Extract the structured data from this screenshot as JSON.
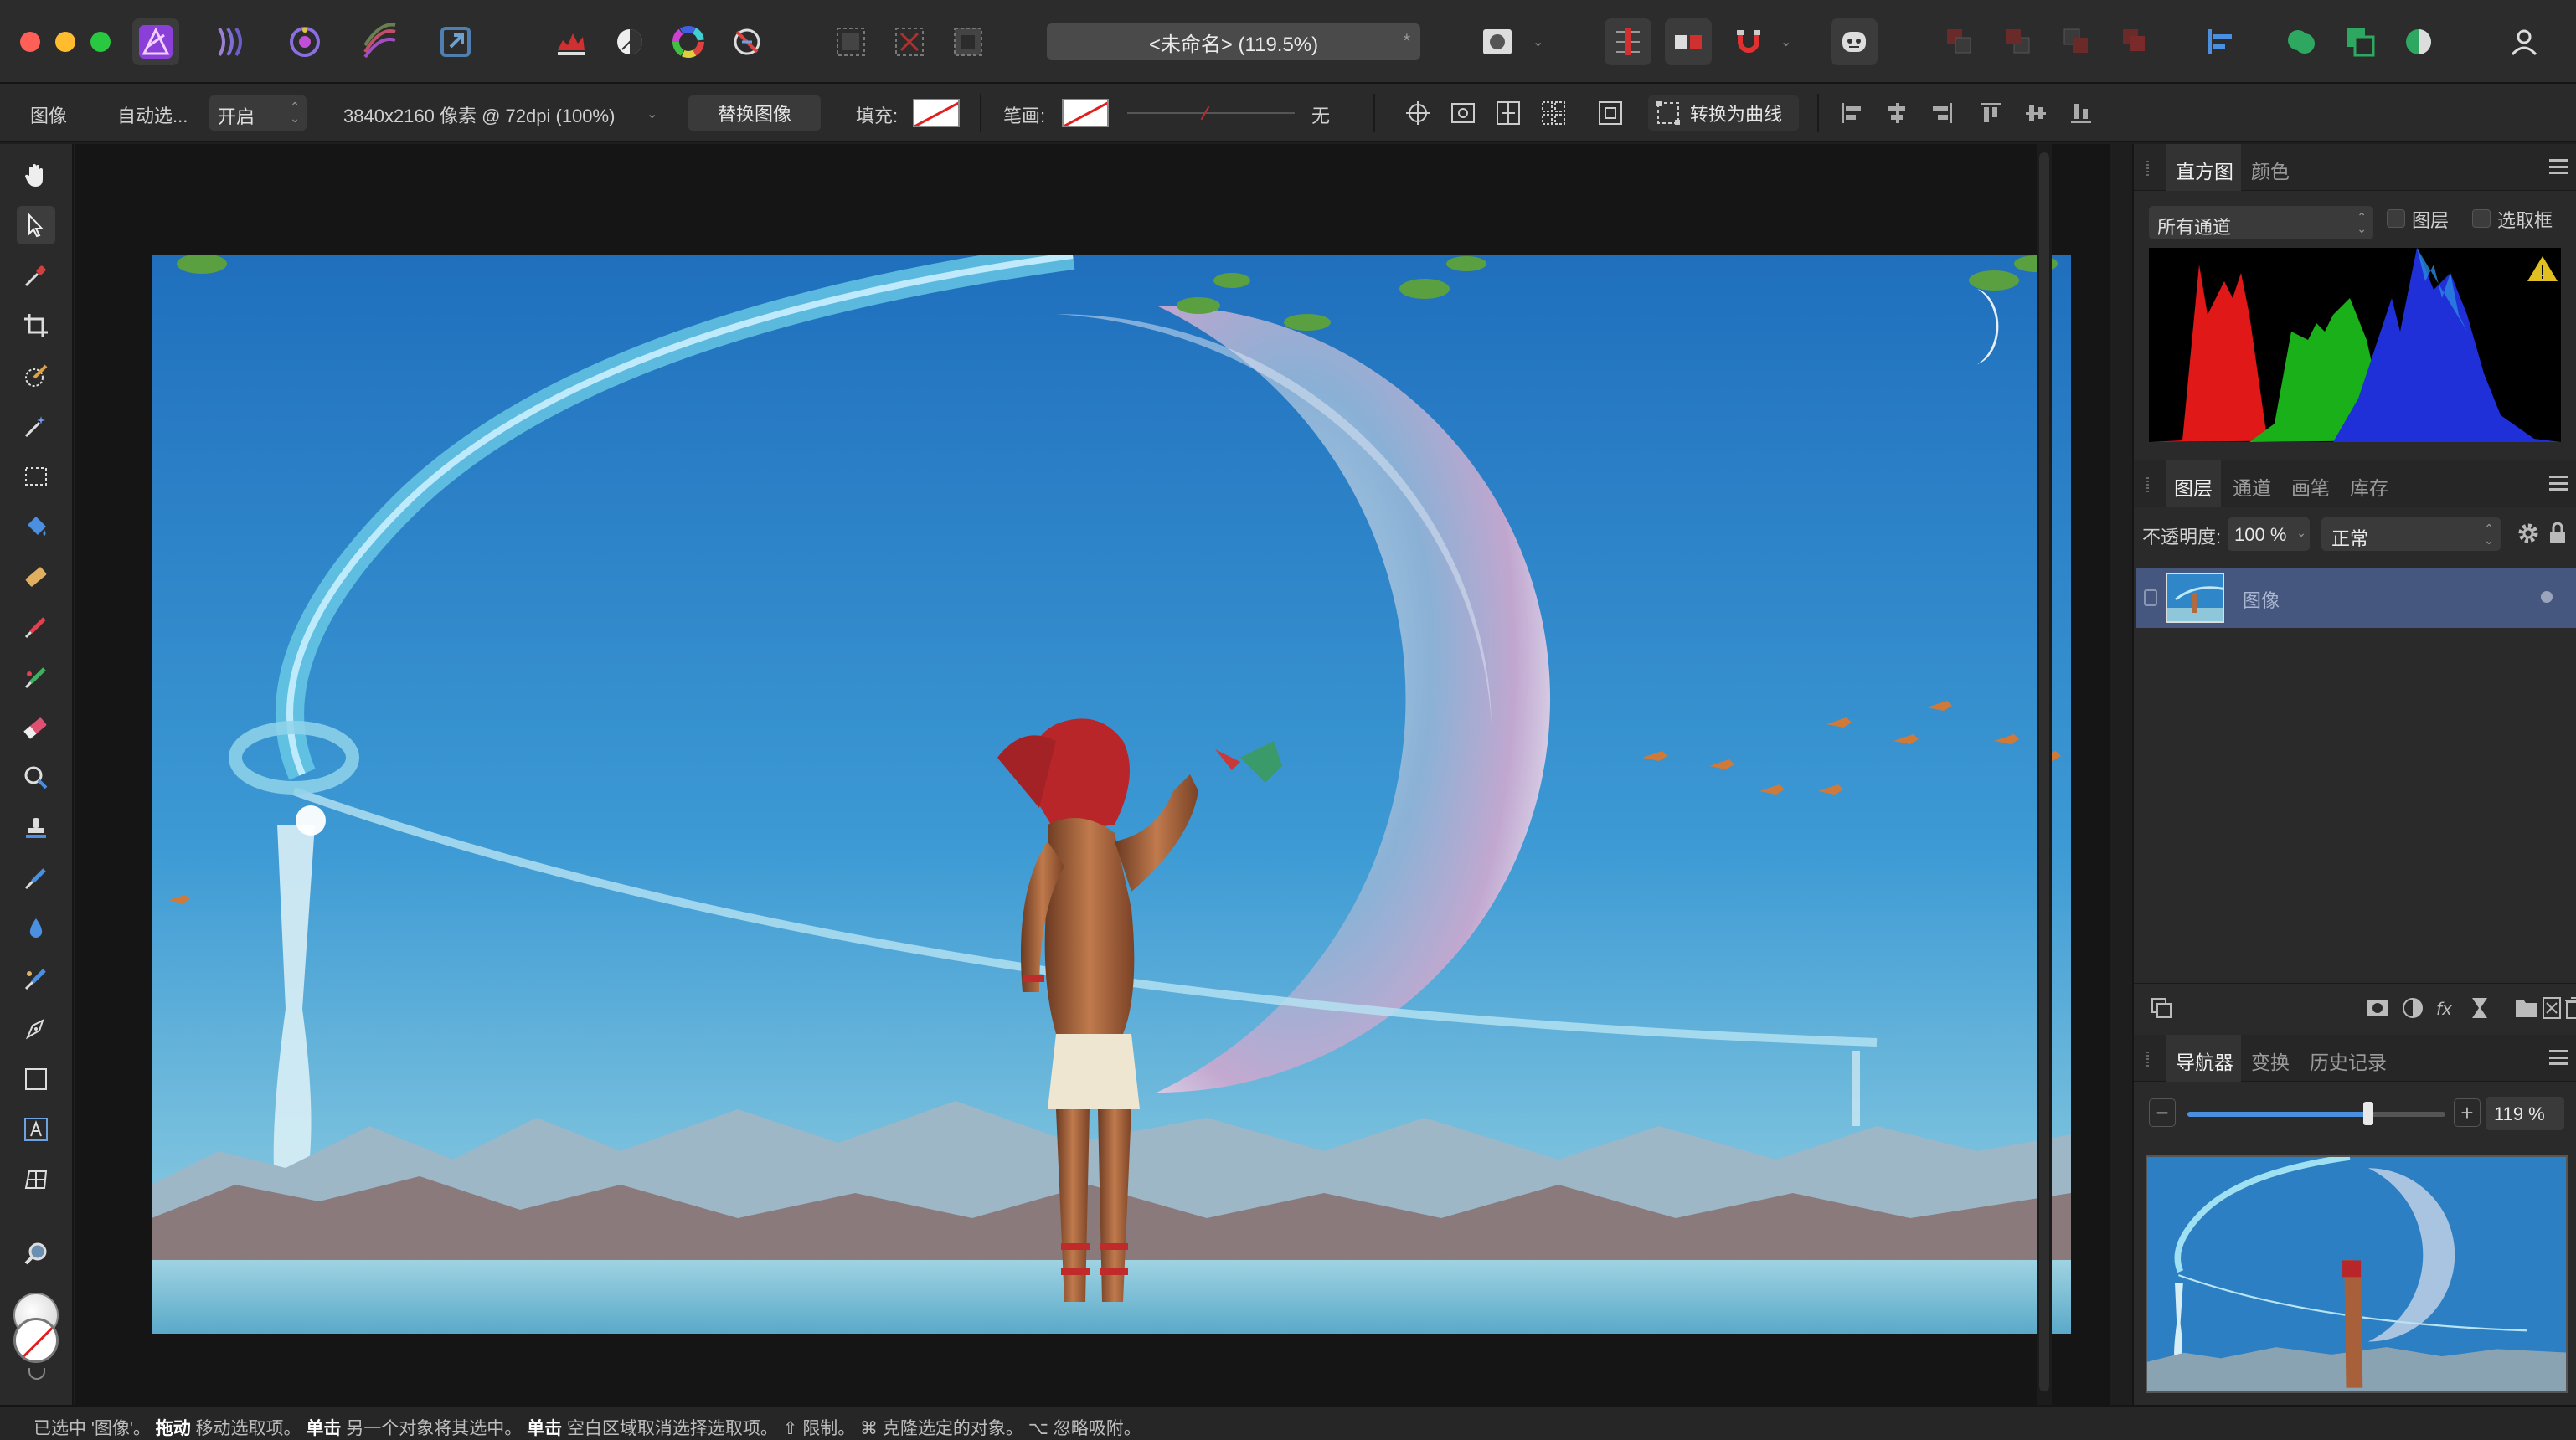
{
  "titlebar": {
    "document_title": "<未命名> (119.5%)",
    "modified_marker": "*",
    "personas": [
      "photo-persona-icon",
      "liquify-persona-icon",
      "develop-persona-icon",
      "tone-mapping-persona-icon",
      "export-persona-icon"
    ]
  },
  "context_toolbar": {
    "label_image": "图像",
    "auto_select_label": "自动选...",
    "auto_select_value": "开启",
    "dimensions": "3840x2160 像素 @ 72dpi (100%)",
    "replace_image": "替换图像",
    "fill_label": "填充:",
    "stroke_label": "笔画:",
    "stroke_width_value": "无",
    "convert_to_curves": "转换为曲线"
  },
  "histogram_panel": {
    "tabs": [
      "直方图",
      "颜色"
    ],
    "channel": "所有通道",
    "checkbox_layer": "图层",
    "checkbox_selection": "选取框"
  },
  "layers_panel": {
    "tabs": [
      "图层",
      "通道",
      "画笔",
      "库存"
    ],
    "opacity_label": "不透明度:",
    "opacity_value": "100 %",
    "blend_mode": "正常",
    "layers": [
      {
        "name": "图像"
      }
    ]
  },
  "navigator_panel": {
    "tabs": [
      "导航器",
      "变换",
      "历史记录"
    ],
    "zoom_value": "119 %",
    "zoom_fraction": 0.7
  },
  "statusbar": {
    "parts": [
      {
        "t": "已选中 '图像'。",
        "b": false
      },
      {
        "t": "拖动",
        "b": true
      },
      {
        "t": " 移动选取项。",
        "b": false
      },
      {
        "t": "单击",
        "b": true
      },
      {
        "t": " 另一个对象将其选中。",
        "b": false
      },
      {
        "t": "单击",
        "b": true
      },
      {
        "t": " 空白区域取消选择选取项。",
        "b": false
      },
      {
        "t": "⇧ 限制。",
        "b": false
      },
      {
        "t": "⌘ 克隆选定的对象。",
        "b": false
      },
      {
        "t": "⌥ 忽略吸附。",
        "b": false
      }
    ]
  },
  "colors": {
    "accent": "#4a8fe0",
    "layer_selected": "#45577f",
    "close": "#fe5f57",
    "minimize": "#febc2e",
    "zoom": "#28c840"
  }
}
